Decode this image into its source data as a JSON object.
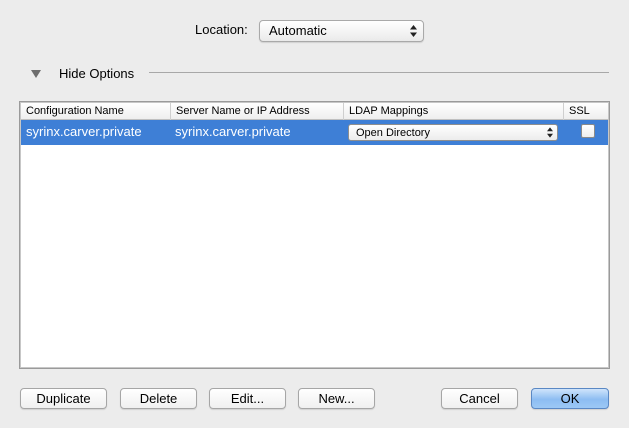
{
  "location": {
    "label": "Location:",
    "value": "Automatic"
  },
  "options": {
    "toggle_label": "Hide Options"
  },
  "table": {
    "columns": [
      "Configuration Name",
      "Server Name or IP Address",
      "LDAP Mappings",
      "SSL"
    ],
    "rows": [
      {
        "config_name": "syrinx.carver.private",
        "server": "syrinx.carver.private",
        "mapping": "Open Directory",
        "ssl": false,
        "selected": true
      }
    ],
    "selection_color": "#3e7fd6"
  },
  "buttons": {
    "duplicate": "Duplicate",
    "delete": "Delete",
    "edit": "Edit...",
    "new": "New...",
    "cancel": "Cancel",
    "ok": "OK"
  },
  "icons": {
    "popup_arrows": "updown-arrows-icon",
    "disclosure": "disclosure-triangle-down-icon"
  }
}
